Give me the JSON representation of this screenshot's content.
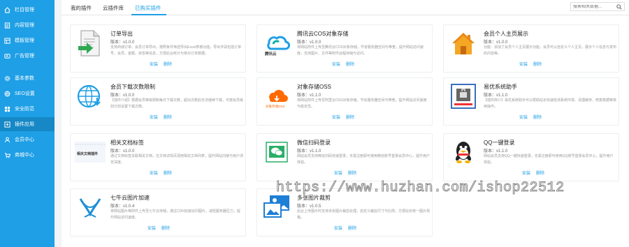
{
  "sidebar": {
    "items": [
      {
        "label": "栏目管理",
        "icon": "home-icon"
      },
      {
        "label": "内容管理",
        "icon": "document-icon"
      },
      {
        "label": "模板管理",
        "icon": "template-icon"
      },
      {
        "label": "广告管理",
        "icon": "ad-icon"
      },
      {
        "label": "基本参数",
        "icon": "gear-icon"
      },
      {
        "label": "SEO设置",
        "icon": "seo-icon"
      },
      {
        "label": "安全防范",
        "icon": "shield-icon"
      },
      {
        "label": "插件应用",
        "icon": "plugin-icon"
      },
      {
        "label": "会员中心",
        "icon": "user-icon"
      },
      {
        "label": "商城中心",
        "icon": "shop-icon"
      }
    ]
  },
  "tabs": [
    {
      "label": "我的插件"
    },
    {
      "label": "云插件库"
    },
    {
      "label": "已购买插件"
    }
  ],
  "search": {
    "placeholder": "搜索相关数据..."
  },
  "cards": [
    {
      "title": "订单导出",
      "version": "版本：v1.0.0",
      "desc": "支持商城订单、会员订单导出，按照条件筛选导出Excel表格功能，导出字段包括订单号、会员、金额、状态等信息，方便后台统计与核对订单数据。",
      "install": "安装",
      "delete": "删除",
      "icon": "export-doc-icon"
    },
    {
      "title": "腾讯云COS对象存储",
      "version": "版本：v1.0.0",
      "desc": "将网站附件上传至腾讯云COS对象存储，节省服务器空间与带宽，提升网站访问速度，支持图片、文件等附件远程存储与访问。",
      "install": "安装",
      "delete": "删除",
      "icon": "tencent-cloud-icon",
      "icon_text": "腾讯云"
    },
    {
      "title": "会员个人主页展示",
      "version": "版本：v1.0.0",
      "desc": "功能：添加了会员个人主页展示功能，会员可以自定义个人主页，展示个人信息与发布的内容等。",
      "install": "安装",
      "delete": "删除",
      "icon": "home-house-icon"
    },
    {
      "title": "会员下载次数限制",
      "version": "版本：v1.0.0",
      "desc": "【插件介绍】根据会员等级限制每日下载次数，超出次数后无法继续下载，可按会员级别分别设置下载次数。",
      "install": "安装",
      "delete": "删除",
      "icon": "globe-download-icon"
    },
    {
      "title": "对象存储OSS",
      "version": "版本：v1.1.0",
      "desc": "将网站附件上传至阿里云OSS对象存储，节省服务器空间与带宽，提升网站访问速度与稳定性。",
      "install": "安装",
      "delete": "删除",
      "icon": "aliyun-oss-icon",
      "icon_text": "对象存储OSS"
    },
    {
      "title": "易优系统助手",
      "version": "版本：v1.1.0",
      "desc": "【插件简介】易优系统助手可以帮助站长快速检测系统环境、清理缓存、修复数据等常用操作。",
      "install": "安装",
      "delete": "删除",
      "icon": "system-helper-icon"
    },
    {
      "title": "相关文档标签",
      "version": "版本：v1.0.0",
      "desc": "通过文档标签关联相关文档，在文档详情页调用相关文档列表，提升网站内链与用户浏览深度。",
      "install": "安装",
      "delete": "删除",
      "icon": "related-tags-icon",
      "icon_text": "相关文档插件"
    },
    {
      "title": "微信扫码登录",
      "version": "版本：v1.1.0",
      "desc": "网站会员支持微信扫码快速登录，无需注册即可使用微信账号登录会员中心，提升用户体验。",
      "install": "安装",
      "delete": "删除",
      "icon": "wechat-login-icon"
    },
    {
      "title": "QQ一键登录",
      "version": "版本：v1.1.0",
      "desc": "网站会员支持QQ一键快速登录，无需注册即可使用QQ账号登录会员中心，提升用户体验。",
      "install": "安装",
      "delete": "删除",
      "icon": "qq-login-icon"
    },
    {
      "title": "七牛云图片加速",
      "version": "版本：v1.0.4",
      "desc": "将网站图片等附件上传至七牛云存储，通过CDN加速访问图片，减轻服务器压力，提升网站访问速度。",
      "install": "安装",
      "delete": "删除",
      "icon": "qiniu-cloud-icon"
    },
    {
      "title": "多张图片裁剪",
      "version": "版本：v1.0.5",
      "desc": "后台上传图片时支持多张图片裁剪处理，自定义裁剪尺寸与比例，方便站长统一图片规格。",
      "install": "安装",
      "delete": "删除",
      "icon": "image-crop-icon"
    }
  ],
  "watermark": "https://www.huzhan.com/ishop22512",
  "colors": {
    "primary": "#1e9fe6",
    "sidebar_active": "#1688c6"
  }
}
